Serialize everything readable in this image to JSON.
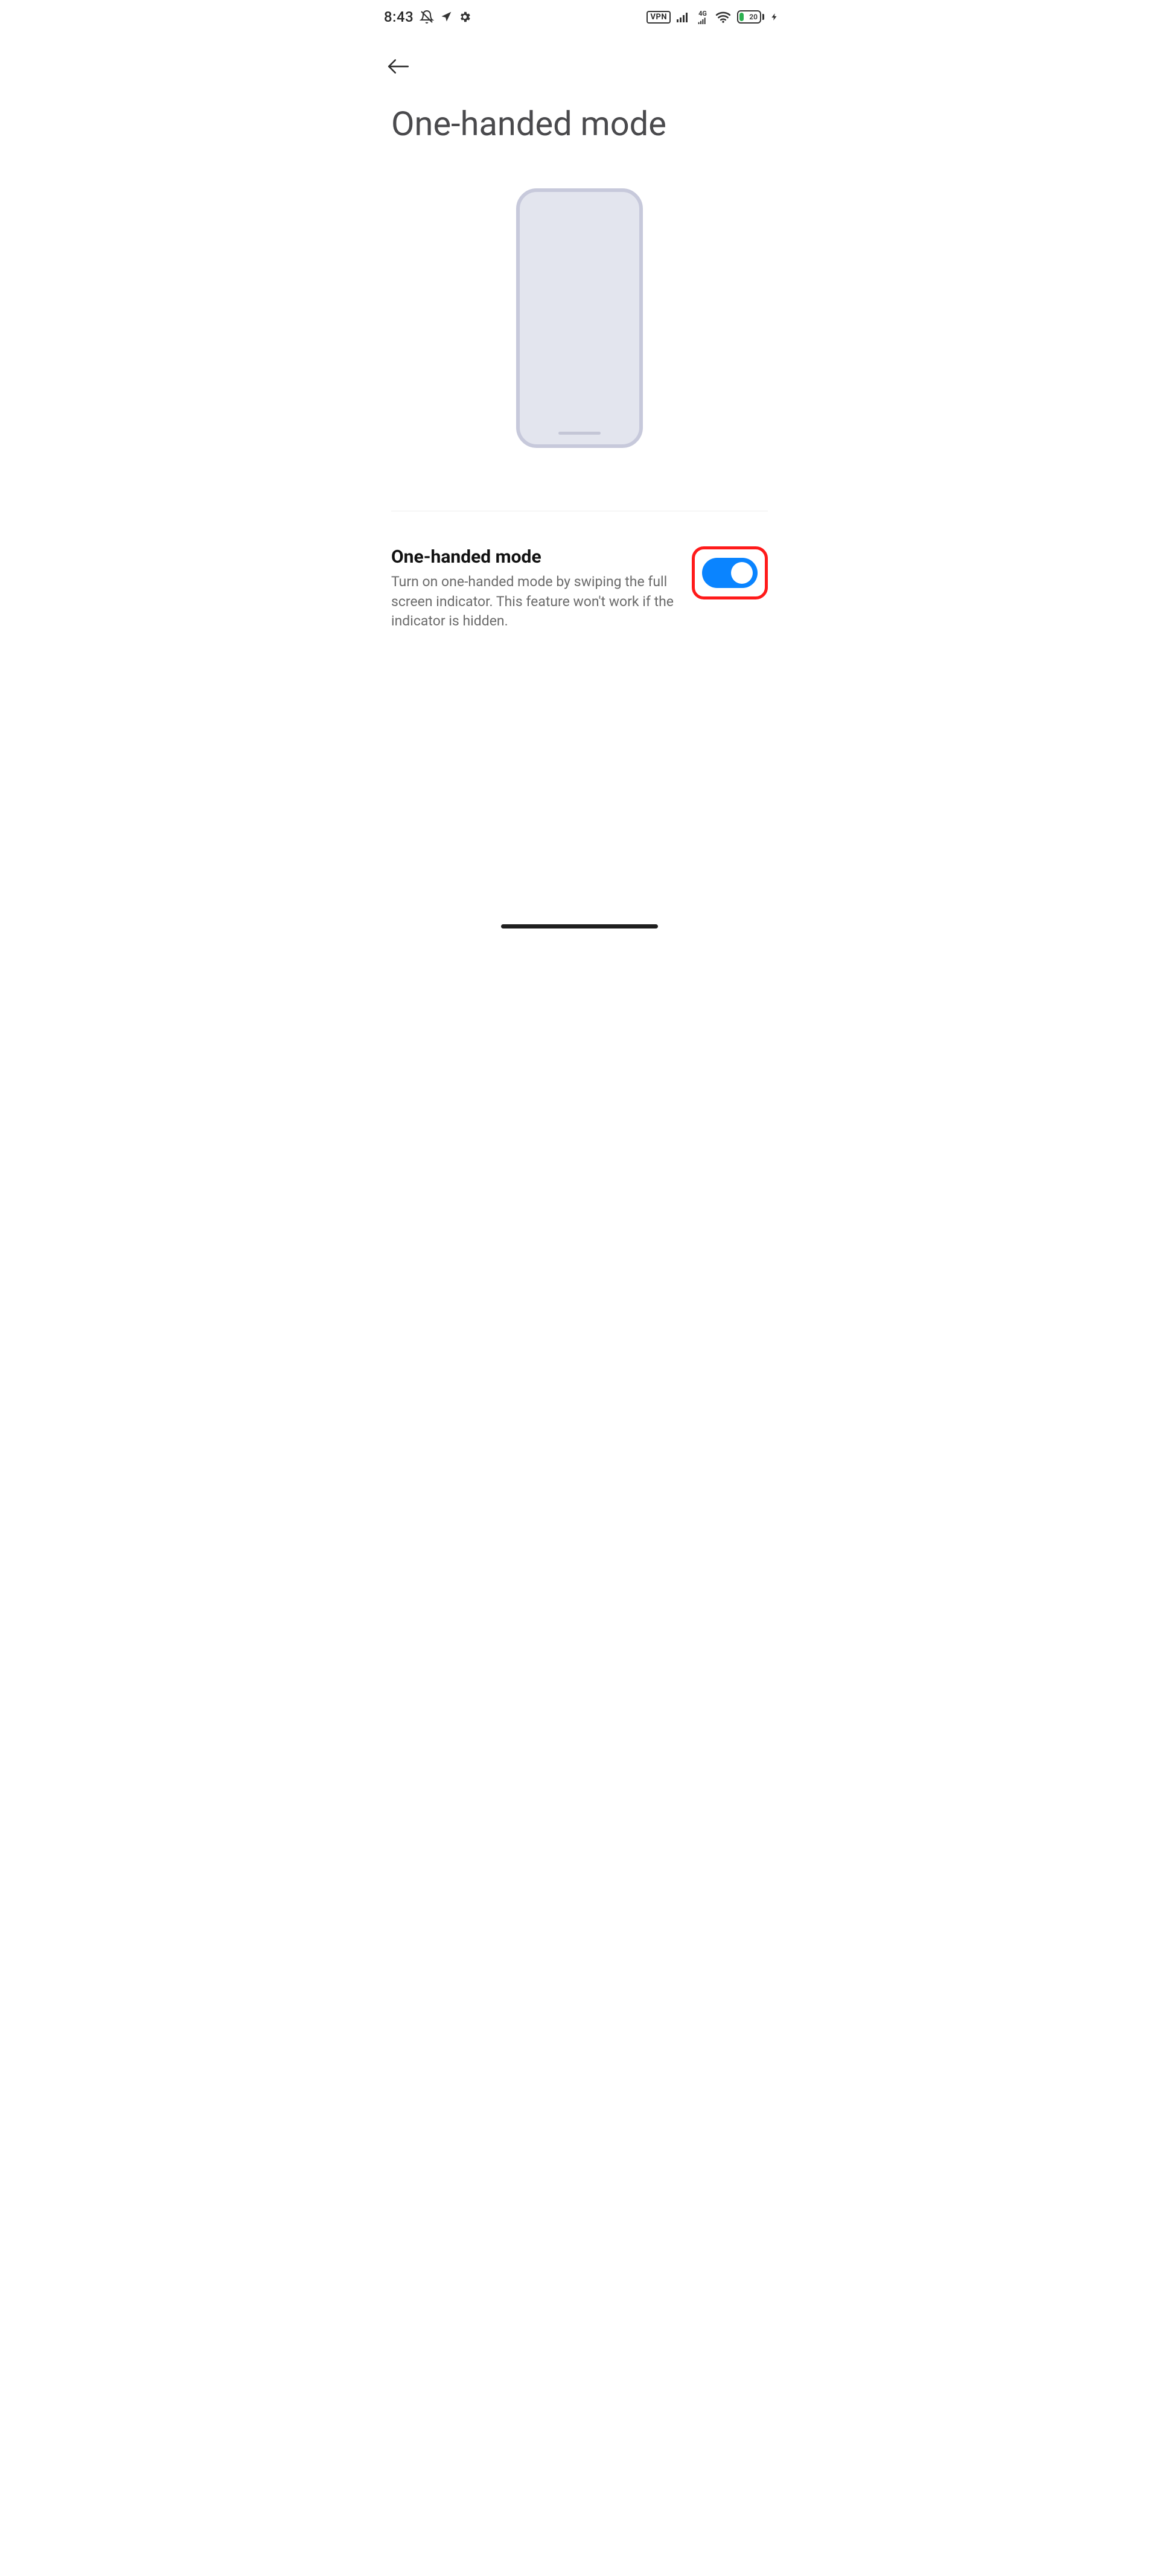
{
  "status": {
    "time": "8:43",
    "vpn_label": "VPN",
    "network_label": "4G",
    "battery_percent": "20"
  },
  "page": {
    "title": "One-handed mode"
  },
  "setting": {
    "title": "One-handed mode",
    "description": "Turn on one-handed mode by swiping the full screen indicator. This feature won't work if the indicator is hidden.",
    "enabled": true
  },
  "colors": {
    "accent": "#0a84ff",
    "highlight": "#ff1a1a"
  }
}
